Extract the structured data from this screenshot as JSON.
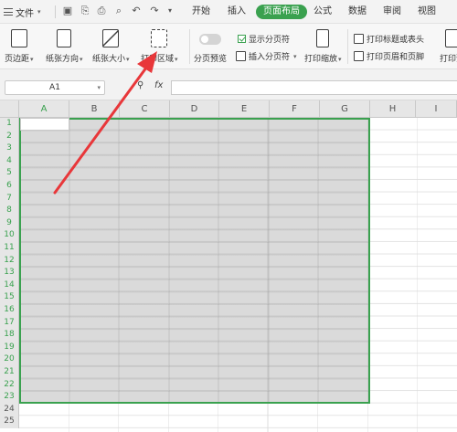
{
  "menubar": {
    "file_label": "文件",
    "tabs": [
      "开始",
      "插入",
      "页面布局",
      "公式",
      "数据",
      "审阅",
      "视图"
    ],
    "active_tab_index": 2
  },
  "ribbon": {
    "margins_label": "页边距",
    "orientation_label": "纸张方向",
    "size_label": "纸张大小",
    "print_area_label": "打印区域",
    "page_break_preview_label": "分页预览",
    "show_page_break_label": "显示分页符",
    "insert_page_break_label": "插入分页符",
    "print_scale_label": "打印缩放",
    "print_titles_label": "打印标题或表头",
    "print_header_footer_label": "打印页眉和页脚",
    "print_preview_label": "打印预"
  },
  "formula_bar": {
    "cell_reference": "A1",
    "fx_label": "fx",
    "formula_value": ""
  },
  "sheet": {
    "columns": [
      "A",
      "B",
      "C",
      "D",
      "E",
      "F",
      "G",
      "H",
      "I"
    ],
    "rows": [
      "1",
      "2",
      "3",
      "4",
      "5",
      "6",
      "7",
      "8",
      "9",
      "10",
      "11",
      "12",
      "13",
      "14",
      "15",
      "16",
      "17",
      "18",
      "19",
      "20",
      "21",
      "22",
      "23",
      "24",
      "25"
    ],
    "print_area_color": "#3aa14f"
  },
  "annotation": {
    "arrow_color": "#e8373a"
  }
}
